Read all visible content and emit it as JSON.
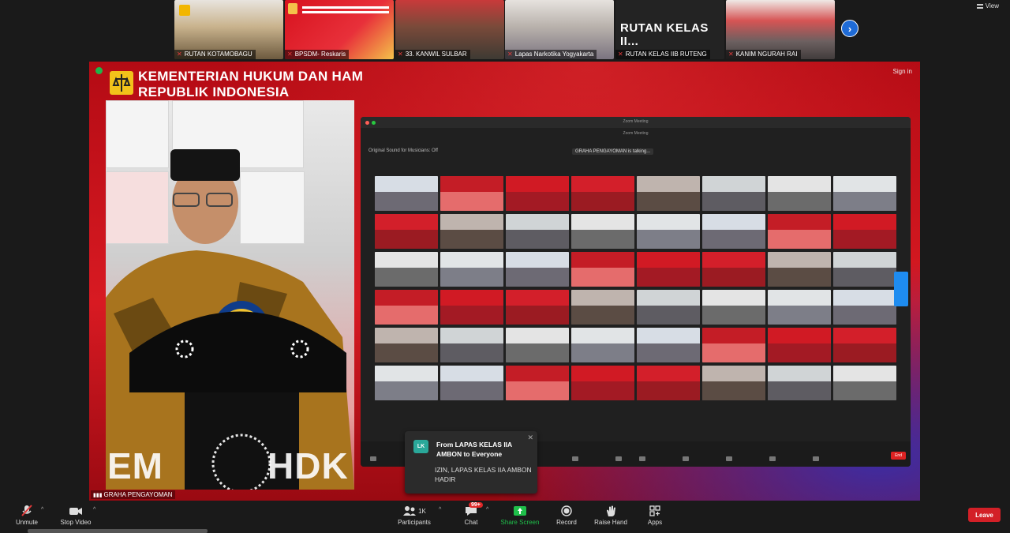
{
  "gallery": {
    "thumbs": [
      {
        "label": "RUTAN KOTAMOBAGU",
        "big_text": ""
      },
      {
        "label": "BPSDM- Reskaris",
        "big_text": ""
      },
      {
        "label": "33. KANWIL SULBAR",
        "big_text": ""
      },
      {
        "label": "Lapas Narkotika Yogyakarta",
        "big_text": ""
      },
      {
        "label": "RUTAN KELAS IIB RUTENG",
        "big_text": "RUTAN KELAS II..."
      },
      {
        "label": "KANIM NGURAH RAI",
        "big_text": ""
      }
    ],
    "view_label": "View"
  },
  "stage": {
    "org_line1": "KEMENTERIAN HUKUM DAN HAM",
    "org_line2": "REPUBLIK INDONESIA",
    "sign_in": "Sign in",
    "podium_text": "EM",
    "podium_text2": "HDK",
    "speaker_label": "GRAHA PENGAYOMAN"
  },
  "shared_screen": {
    "title": "Zoom Meeting",
    "subtitle": "Zoom Meeting",
    "original_sound": "Original Sound for Musicians: Off",
    "talking": "GRAHA PENGAYOMAN is talking..."
  },
  "chat_popup": {
    "avatar": "LK",
    "from": "From LAPAS KELAS IIA AMBON to Everyone",
    "message": "IZIN, LAPAS KELAS IIA AMBON HADIR"
  },
  "controls": {
    "unmute": "Unmute",
    "stop_video": "Stop Video",
    "participants": "Participants",
    "participants_count": "1K",
    "chat": "Chat",
    "chat_badge": "99+",
    "share_screen": "Share Screen",
    "record": "Record",
    "raise_hand": "Raise Hand",
    "apps": "Apps",
    "leave": "Leave"
  },
  "colors": {
    "leave": "#d32027",
    "share_green": "#1fbf4a",
    "stage_red": "#d81a22"
  }
}
